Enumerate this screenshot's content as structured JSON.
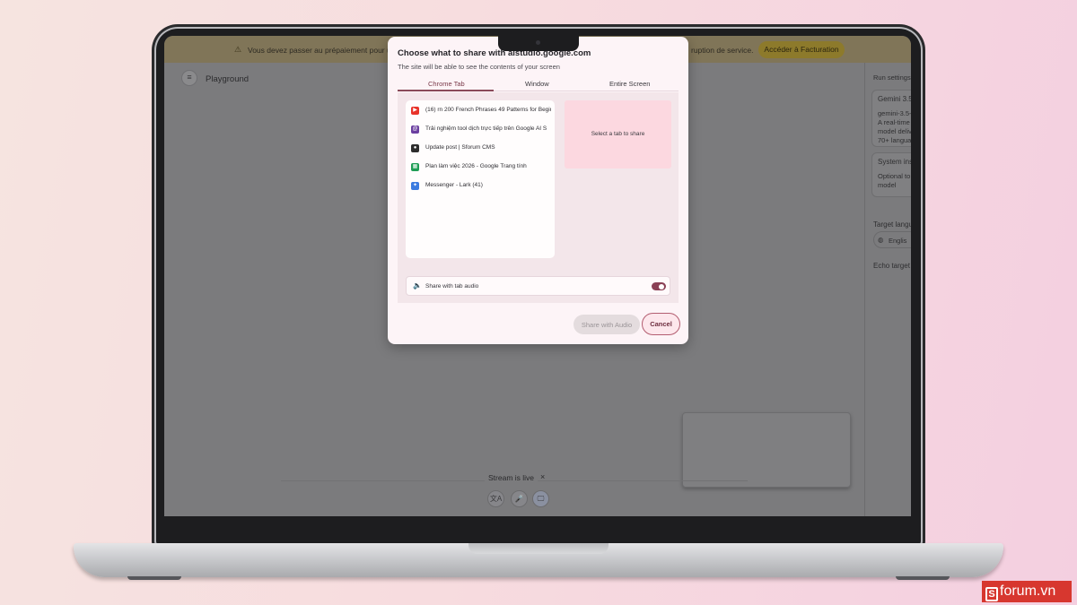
{
  "banner": {
    "warning_icon": "⚠",
    "message_left": "Vous devez passer au prépaiement pour u",
    "message_right": "ruption de service.",
    "billing_button": "Accéder à Facturation"
  },
  "app": {
    "menu_icon": "≡",
    "title": "Playground"
  },
  "right_panel": {
    "run_settings": "Run settings",
    "model_name": "Gemini 3.5",
    "model_id": "gemini-3.5-",
    "model_desc_1": "A real-time",
    "model_desc_2": "model delive",
    "model_desc_3": "70+ langua",
    "system_title": "System ins",
    "system_desc_1": "Optional to",
    "system_desc_2": "model",
    "target_language_label": "Target langu",
    "target_language_value": "Englis",
    "echo_target": "Echo target"
  },
  "stream": {
    "status": "Stream is live",
    "close": "×",
    "controls": [
      "文A",
      "🎤",
      "🖵"
    ]
  },
  "dialog": {
    "title": "Choose what to share with aistudio.google.com",
    "subtitle": "The site will be able to see the contents of your screen",
    "tabs": [
      "Chrome Tab",
      "Window",
      "Entire Screen"
    ],
    "chrome_tabs": [
      {
        "label": "(16) rn 200 French Phrases 49 Patterns for Begir",
        "icon": "youtube-icon",
        "glyph": "▶",
        "color": "#e8332a"
      },
      {
        "label": "Trải nghiệm tool dịch trực tiếp trên Google AI S",
        "icon": "at-icon",
        "glyph": "@",
        "color": "#6b3fa0"
      },
      {
        "label": "Update post | Sforum CMS",
        "icon": "avatar-icon",
        "glyph": "●",
        "color": "#2d2d2d"
      },
      {
        "label": "Plan làm việc 2026 - Google Trang tính",
        "icon": "sheets-icon",
        "glyph": "▦",
        "color": "#1f9d55"
      },
      {
        "label": "Messenger - Lark (41)",
        "icon": "lark-icon",
        "glyph": "✦",
        "color": "#3a7be0"
      }
    ],
    "preview_text": "Select a tab to share",
    "audio_label": "Share with tab audio",
    "share_button": "Share with Audio",
    "cancel_button": "Cancel"
  },
  "watermark": {
    "mark": "S",
    "text": "forum.vn"
  }
}
